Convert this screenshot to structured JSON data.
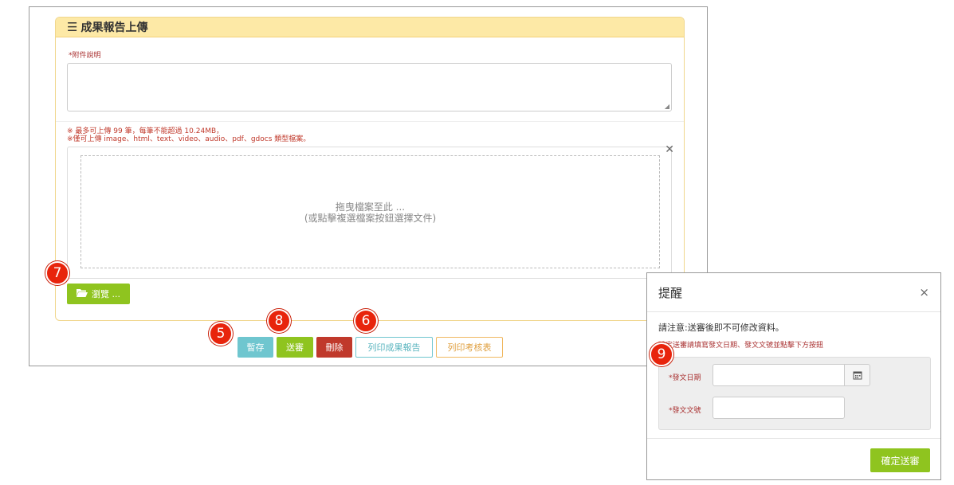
{
  "panel": {
    "title": "成果報告上傳",
    "title_icon": "hamburger-icon",
    "attachment_label": "*附件說明",
    "notes": [
      "※ 最多可上傳 99 筆，每筆不能超過 10.24MB，",
      "※僅可上傳 image、html、text、video、audio、pdf、gdocs 類型檔案。"
    ],
    "dropzone": {
      "line1": "拖曳檔案至此 ...",
      "line2": "(或點擊複選檔案按鈕選擇文件)"
    },
    "browse_label": "瀏覽 ..."
  },
  "actions": {
    "save_draft": "暫存",
    "submit": "送審",
    "delete": "刪除",
    "print_report": "列印成果報告",
    "print_evaluation": "列印考核表"
  },
  "badges": [
    "7",
    "5",
    "8",
    "6",
    "9"
  ],
  "modal": {
    "title": "提醒",
    "close": "×",
    "warning": "請注意:送審後即不可修改資料。",
    "hint": "確定送審請填寫發文日期、發文文號並點擊下方按鈕",
    "date_label": "*發文日期",
    "number_label": "*發文文號",
    "confirm": "確定送審"
  },
  "colors": {
    "panel_header": "#fde9a6",
    "green": "#8fc41f",
    "teal": "#6fc6cf",
    "red": "#c0392b",
    "badge": "#e8240c"
  }
}
